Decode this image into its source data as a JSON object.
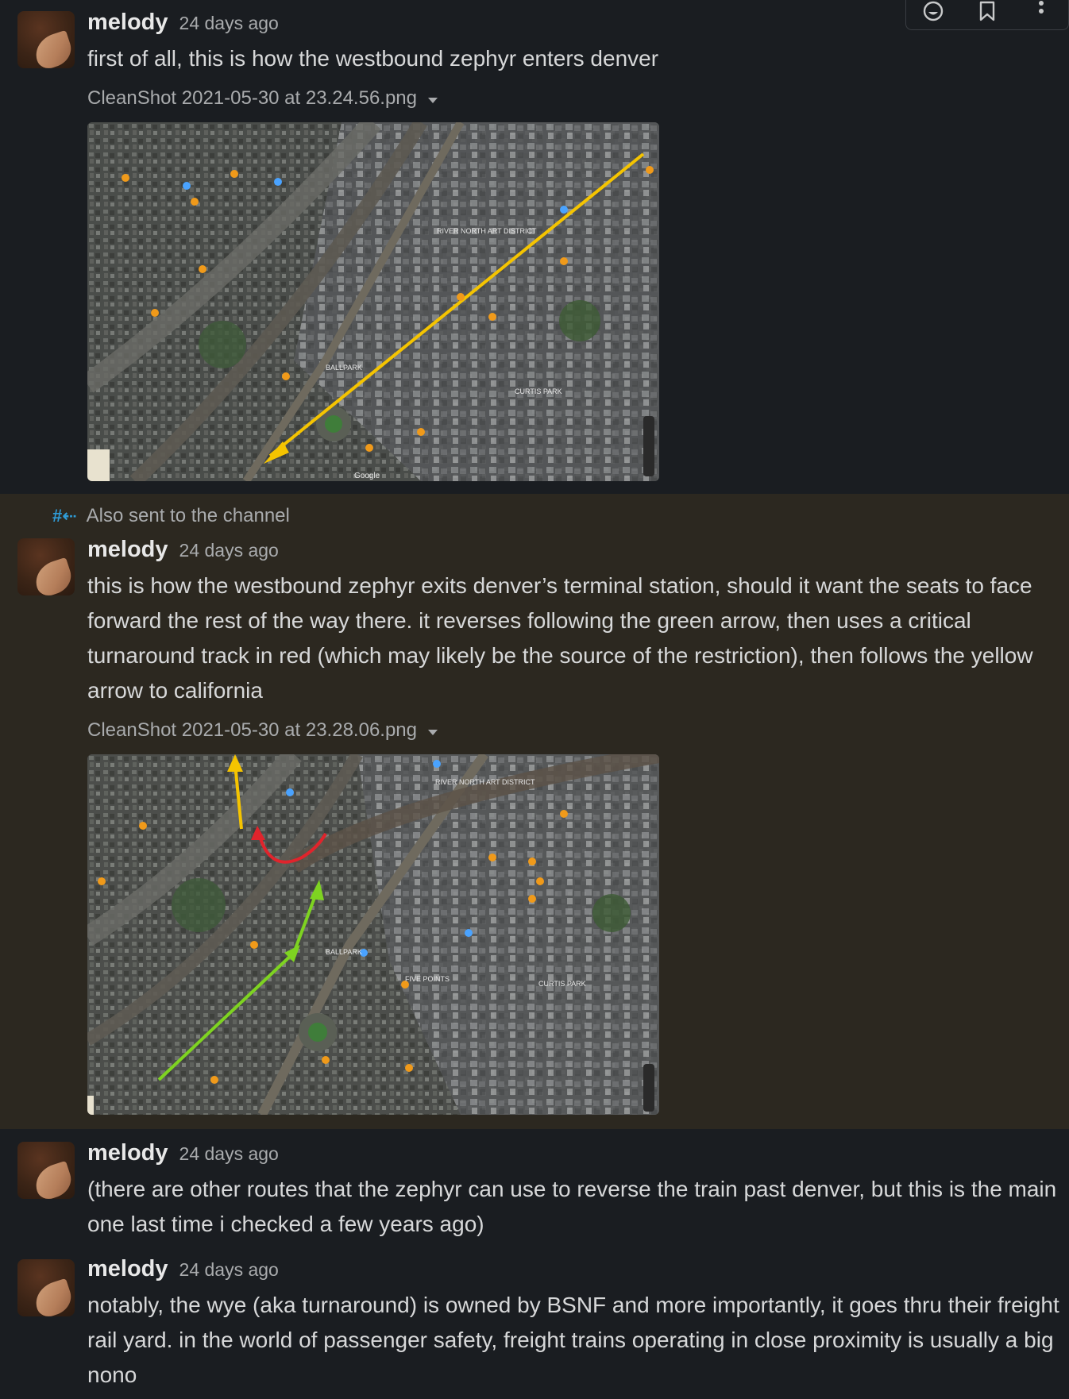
{
  "toolbar": {
    "icons": [
      "emoji-icon",
      "bookmark-icon",
      "more-icon"
    ]
  },
  "messages": [
    {
      "author": "melody",
      "time": "24 days ago",
      "text": "first of all, this is how the westbound zephyr enters denver",
      "file_name": "CleanShot 2021-05-30 at 23.24.56.png"
    },
    {
      "also_sent": "Also sent to the channel",
      "author": "melody",
      "time": "24 days ago",
      "text": "this is how the westbound zephyr exits denver’s terminal station, should it want the seats to face forward the rest of the way there. it reverses following the green arrow, then uses a critical turnaround track in red (which may likely be the source of the restriction), then follows the yellow arrow to california",
      "file_name": "CleanShot 2021-05-30 at 23.28.06.png"
    },
    {
      "author": "melody",
      "time": "24 days ago",
      "text": "(there are other routes that the zephyr can use to reverse the train past denver, but this is the main one last time i checked a few years ago)"
    },
    {
      "author": "melody",
      "time": "24 days ago",
      "text": "notably, the wye (aka turnaround) is owned by BSNF and more importantly, it goes thru their freight rail yard. in the world of passenger safety, freight trains operating in close proximity is usually a big nono"
    }
  ],
  "map1": {
    "labels": [
      "RIVER NORTH ART DISTRICT",
      "CURTIS PARK",
      "BALLPARK",
      "Google"
    ]
  },
  "map2": {
    "labels": [
      "RIVER NORTH ART DISTRICT",
      "BALLPARK",
      "FIVE POINTS",
      "CURTIS PARK"
    ]
  },
  "colors": {
    "background": "#1a1d21",
    "highlight": "#2c2820",
    "arrow_yellow": "#f5c400",
    "arrow_green": "#7ed321",
    "arrow_red": "#e0242c"
  }
}
